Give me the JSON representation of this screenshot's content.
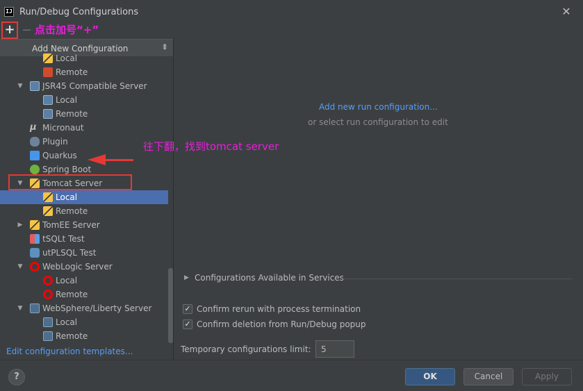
{
  "window": {
    "title": "Run/Debug Configurations",
    "close_glyph": "✕",
    "app_icon_text": "IJ"
  },
  "toolbar": {
    "add_glyph": "+",
    "remove_glyph": "−"
  },
  "annotations": {
    "plus_hint": "点击加号“+”",
    "scroll_hint": "往下翻，找到tomcat server",
    "accent_color": "#e91ee0",
    "highlight_color": "#e53935"
  },
  "popup": {
    "title": "Add New Configuration",
    "pin_glyph": "⇞"
  },
  "tree": {
    "items": [
      {
        "label": "Local",
        "icon": "tomcat-icon",
        "indent": 2,
        "expanded": null
      },
      {
        "label": "Remote",
        "icon": "remote-icon",
        "indent": 2,
        "expanded": null
      },
      {
        "label": "JSR45 Compatible Server",
        "icon": "jsr45-icon",
        "indent": 1,
        "expanded": true
      },
      {
        "label": "Local",
        "icon": "jsr45-icon",
        "indent": 2,
        "expanded": null
      },
      {
        "label": "Remote",
        "icon": "jsr45-icon",
        "indent": 2,
        "expanded": null
      },
      {
        "label": "Micronaut",
        "icon": "micronaut-icon",
        "indent": 1,
        "expanded": null
      },
      {
        "label": "Plugin",
        "icon": "plugin-icon",
        "indent": 1,
        "expanded": null
      },
      {
        "label": "Quarkus",
        "icon": "quarkus-icon",
        "indent": 1,
        "expanded": null
      },
      {
        "label": "Spring Boot",
        "icon": "spring-boot-icon",
        "indent": 1,
        "expanded": null
      },
      {
        "label": "Tomcat Server",
        "icon": "tomcat-icon",
        "indent": 1,
        "expanded": true
      },
      {
        "label": "Local",
        "icon": "tomcat-icon",
        "indent": 2,
        "expanded": null,
        "selected": true
      },
      {
        "label": "Remote",
        "icon": "tomcat-icon",
        "indent": 2,
        "expanded": null
      },
      {
        "label": "TomEE Server",
        "icon": "tomcat-icon",
        "indent": 1,
        "expanded": false
      },
      {
        "label": "tSQLt Test",
        "icon": "tsqlt-icon",
        "indent": 1,
        "expanded": null
      },
      {
        "label": "utPLSQL Test",
        "icon": "utplsql-icon",
        "indent": 1,
        "expanded": null
      },
      {
        "label": "WebLogic Server",
        "icon": "weblogic-icon",
        "indent": 1,
        "expanded": true
      },
      {
        "label": "Local",
        "icon": "weblogic-icon",
        "indent": 2,
        "expanded": null
      },
      {
        "label": "Remote",
        "icon": "weblogic-icon",
        "indent": 2,
        "expanded": null
      },
      {
        "label": "WebSphere/Liberty Server",
        "icon": "websphere-icon",
        "indent": 1,
        "expanded": true
      },
      {
        "label": "Local",
        "icon": "websphere-icon",
        "indent": 2,
        "expanded": null
      },
      {
        "label": "Remote",
        "icon": "websphere-icon",
        "indent": 2,
        "expanded": null
      }
    ],
    "edit_templates_label": "Edit configuration templates..."
  },
  "main": {
    "add_new_link": "Add new run configuration...",
    "or_select": "or select run configuration to edit",
    "services_label": "Configurations Available in Services",
    "confirm_rerun_label": "Confirm rerun with process termination",
    "confirm_rerun_checked": true,
    "confirm_delete_label": "Confirm deletion from Run/Debug popup",
    "confirm_delete_checked": true,
    "limit_label": "Temporary configurations limit:",
    "limit_value": "5"
  },
  "buttons": {
    "help": "?",
    "ok": "OK",
    "cancel": "Cancel",
    "apply": "Apply"
  }
}
